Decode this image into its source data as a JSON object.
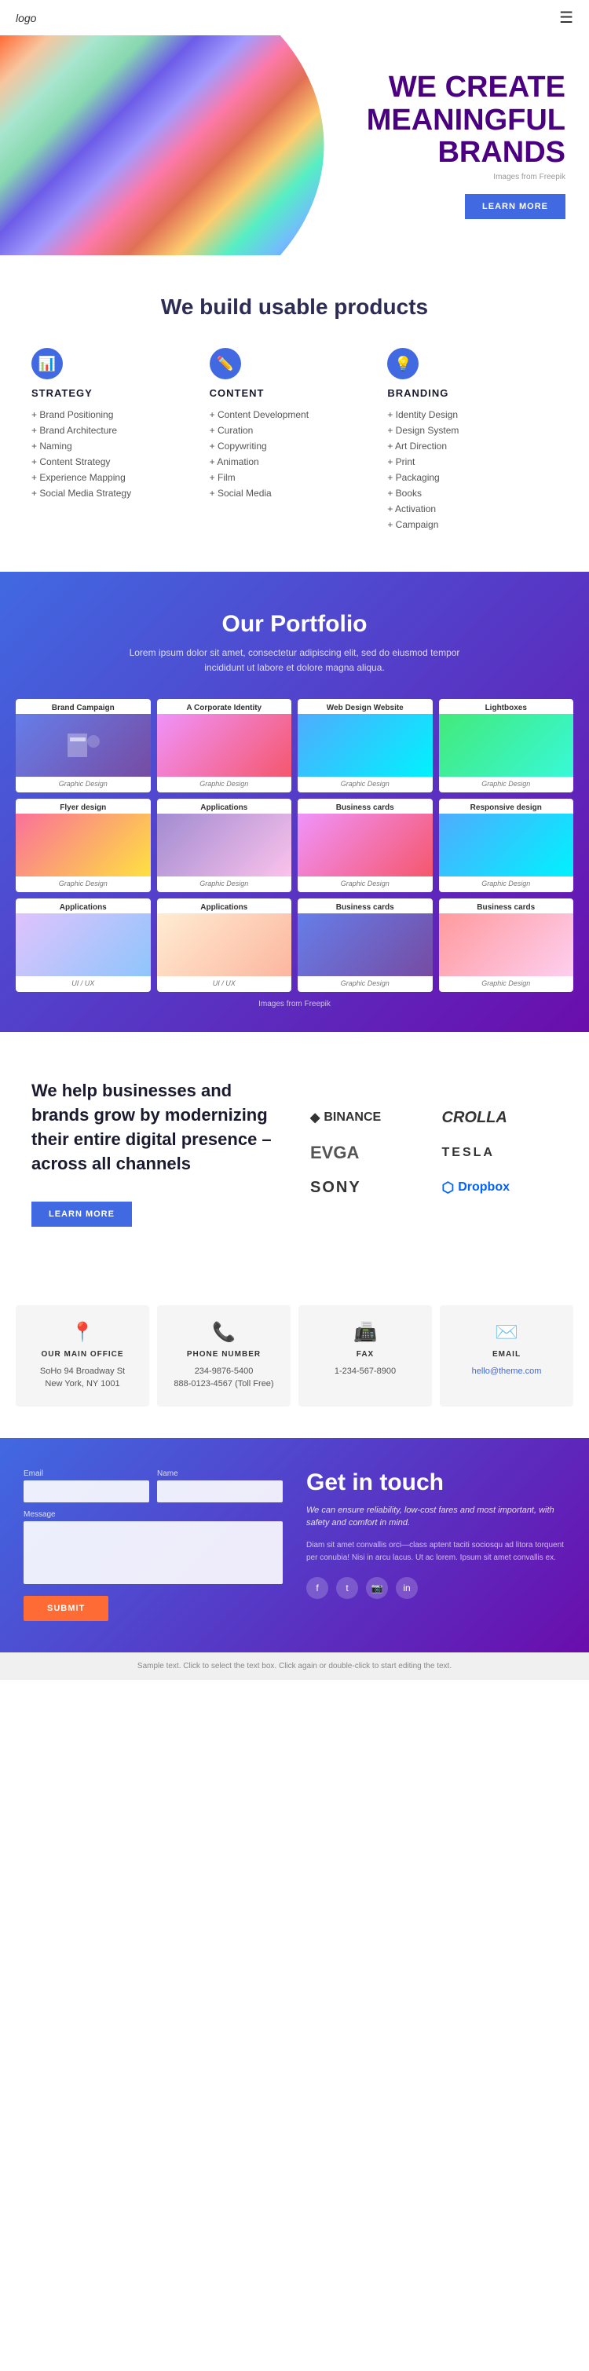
{
  "header": {
    "logo": "logo",
    "hamburger_label": "☰"
  },
  "hero": {
    "title_line1": "WE CREATE",
    "title_line2": "MEANINGFUL",
    "title_line3": "BRANDS",
    "source_text": "Images from Freepik",
    "btn_label": "LEARN MORE"
  },
  "products": {
    "section_title": "We build usable products",
    "columns": [
      {
        "icon": "📊",
        "title": "STRATEGY",
        "items": [
          "Brand Positioning",
          "Brand Architecture",
          "Naming",
          "Content Strategy",
          "Experience Mapping",
          "Social Media Strategy"
        ]
      },
      {
        "icon": "✏️",
        "title": "CONTENT",
        "items": [
          "Content Development",
          "Curation",
          "Copywriting",
          "Animation",
          "Film",
          "Social Media"
        ]
      },
      {
        "icon": "💡",
        "title": "BRANDING",
        "items": [
          "Identity Design",
          "Design System",
          "Art Direction",
          "Print",
          "Packaging",
          "Books",
          "Activation",
          "Campaign"
        ]
      }
    ]
  },
  "portfolio": {
    "title": "Our Portfolio",
    "description": "Lorem ipsum dolor sit amet, consectetur adipiscing elit, sed do eiusmod tempor incididunt ut labore et dolore magna aliqua.",
    "source_text": "Images from Freepik",
    "items": [
      {
        "title": "Brand Campaign",
        "type": "Graphic Design",
        "row": 1
      },
      {
        "title": "A Corporate Identity",
        "type": "Graphic Design",
        "row": 1
      },
      {
        "title": "Web Design Website",
        "type": "Graphic Design",
        "row": 1
      },
      {
        "title": "Lightboxes",
        "type": "Graphic Design",
        "row": 1
      },
      {
        "title": "Flyer design",
        "type": "Graphic Design",
        "row": 2
      },
      {
        "title": "Applications",
        "type": "Graphic Design",
        "row": 2
      },
      {
        "title": "Business cards",
        "type": "Graphic Design",
        "row": 2
      },
      {
        "title": "Responsive design",
        "type": "Graphic Design",
        "row": 2
      },
      {
        "title": "Applications",
        "type": "UI / UX",
        "row": 3
      },
      {
        "title": "Applications",
        "type": "UI / UX",
        "row": 3
      },
      {
        "title": "Business cards",
        "type": "Graphic Design",
        "row": 3
      },
      {
        "title": "Business cards",
        "type": "Graphic Design",
        "row": 3
      }
    ]
  },
  "brands": {
    "title": "We help businesses and brands grow by modernizing their entire digital presence – across all channels",
    "btn_label": "LEARN MORE",
    "logos": [
      {
        "name": "◆ BINANCE",
        "symbol": "◆",
        "text": "BINANCE"
      },
      {
        "name": "CROLLA",
        "symbol": "",
        "text": "CROLLA"
      },
      {
        "name": "EVGA",
        "symbol": "",
        "text": "EVGA"
      },
      {
        "name": "TESLA",
        "symbol": "",
        "text": "TESLA"
      },
      {
        "name": "SONY",
        "symbol": "",
        "text": "SONY"
      },
      {
        "name": "⬡ Dropbox",
        "symbol": "⬡",
        "text": "Dropbox"
      }
    ]
  },
  "contact_info": {
    "cards": [
      {
        "icon": "📍",
        "title": "OUR MAIN OFFICE",
        "info": "SoHo 94 Broadway St\nNew York, NY 1001"
      },
      {
        "icon": "📞",
        "title": "PHONE NUMBER",
        "info": "234-9876-5400\n888-0123-4567 (Toll Free)"
      },
      {
        "icon": "📠",
        "title": "FAX",
        "info": "1-234-567-8900"
      },
      {
        "icon": "✉️",
        "title": "EMAIL",
        "info": "hello@theme.com"
      }
    ]
  },
  "get_in_touch": {
    "form": {
      "email_label": "Email",
      "name_label": "Name",
      "message_label": "Message",
      "submit_label": "SUBMIT"
    },
    "info": {
      "title": "Get in touch",
      "subtitle": "We can ensure reliability, low-cost fares and most important, with safety and comfort in mind.",
      "description": "Diam sit amet convallis orci—class aptent taciti sociosqu ad litora torquent per conubia! Nisi in arcu lacus. Ut ac lorem. Ipsum sit amet convallis ex.",
      "social": [
        "f",
        "t",
        "in",
        "in"
      ]
    }
  },
  "footer": {
    "note": "Sample text. Click to select the text box. Click again or double-click to start editing the text."
  }
}
